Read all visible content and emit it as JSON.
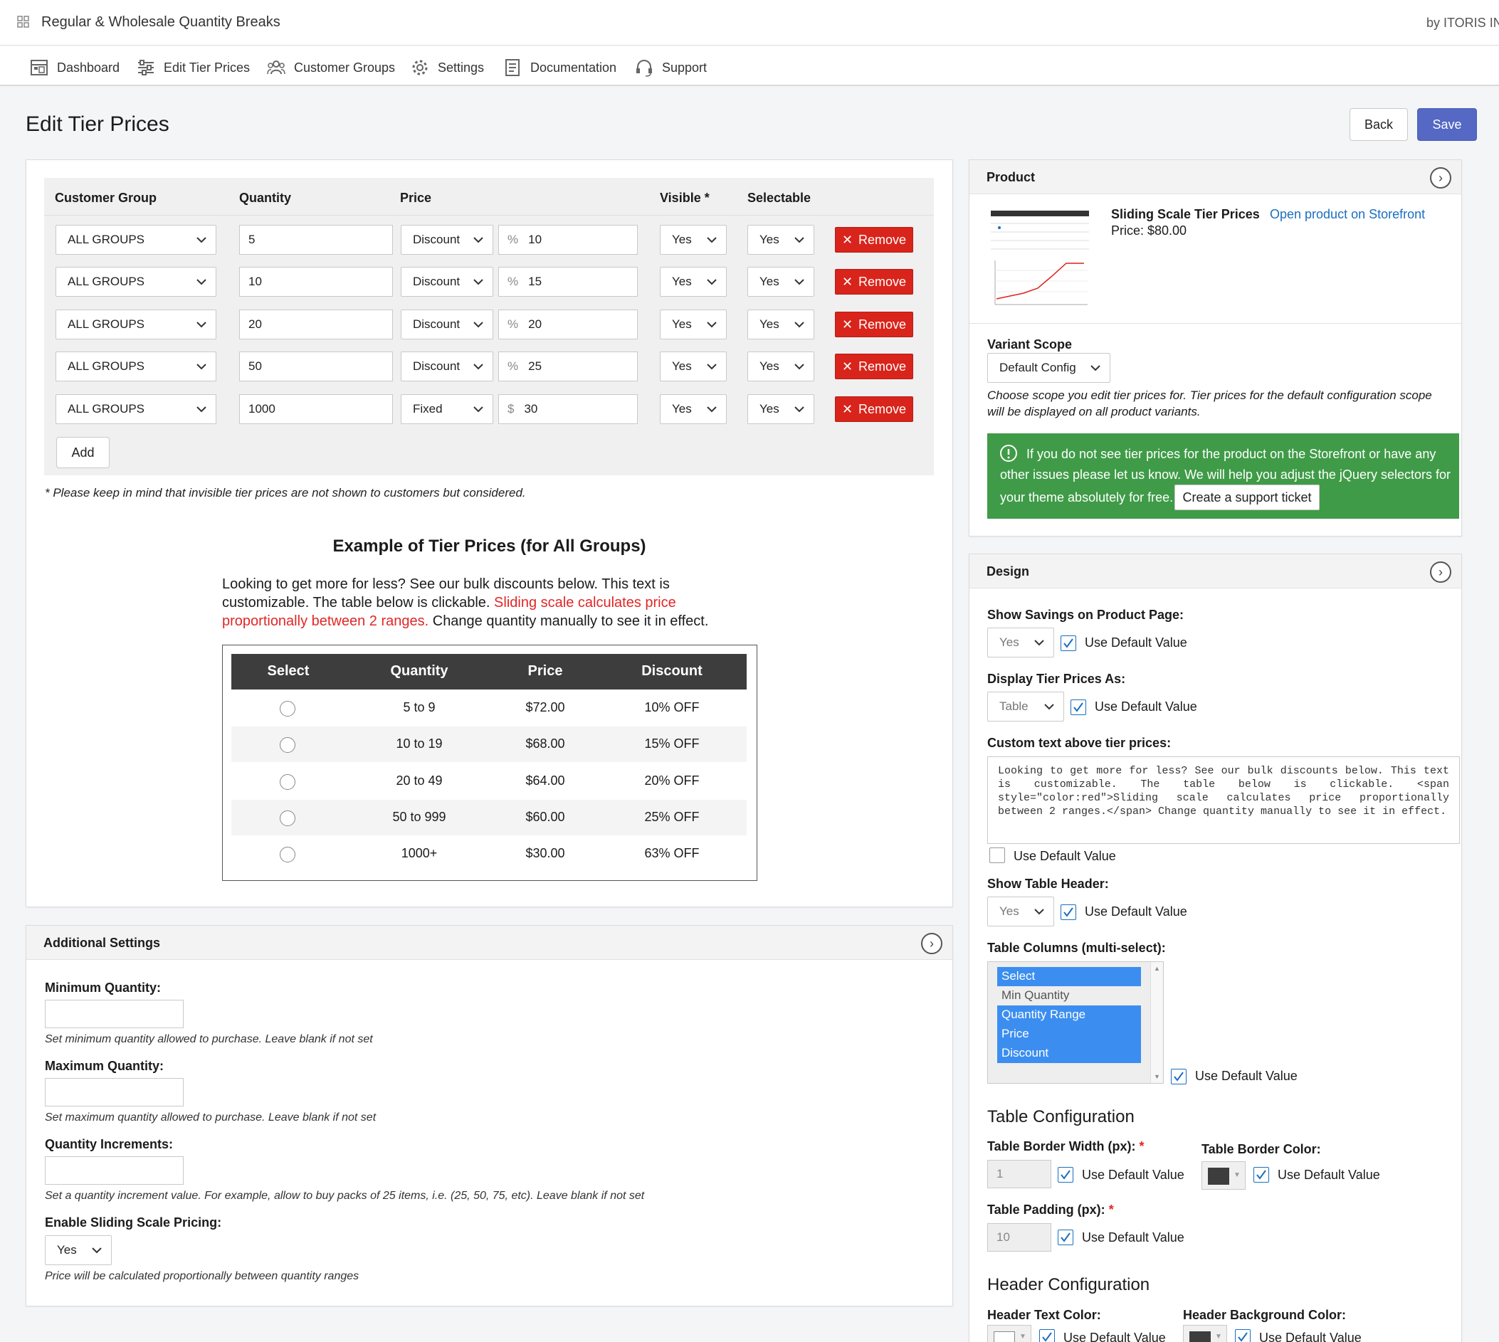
{
  "app": {
    "title": "Regular & Wholesale Quantity Breaks",
    "vendor": "by ITORIS INC"
  },
  "nav": [
    {
      "label": "Dashboard",
      "icon": "dashboard-icon"
    },
    {
      "label": "Edit Tier Prices",
      "icon": "sliders-icon"
    },
    {
      "label": "Customer Groups",
      "icon": "users-icon"
    },
    {
      "label": "Settings",
      "icon": "gear-icon"
    },
    {
      "label": "Documentation",
      "icon": "document-icon"
    },
    {
      "label": "Support",
      "icon": "headset-icon"
    }
  ],
  "page": {
    "title": "Edit Tier Prices",
    "back": "Back",
    "save": "Save"
  },
  "tiers": {
    "headers": {
      "group": "Customer Group",
      "quantity": "Quantity",
      "price": "Price",
      "visible": "Visible *",
      "selectable": "Selectable"
    },
    "rows": [
      {
        "group": "ALL GROUPS",
        "qty": "5",
        "type": "Discount",
        "prefix": "%",
        "value": "10",
        "visible": "Yes",
        "selectable": "Yes"
      },
      {
        "group": "ALL GROUPS",
        "qty": "10",
        "type": "Discount",
        "prefix": "%",
        "value": "15",
        "visible": "Yes",
        "selectable": "Yes"
      },
      {
        "group": "ALL GROUPS",
        "qty": "20",
        "type": "Discount",
        "prefix": "%",
        "value": "20",
        "visible": "Yes",
        "selectable": "Yes"
      },
      {
        "group": "ALL GROUPS",
        "qty": "50",
        "type": "Discount",
        "prefix": "%",
        "value": "25",
        "visible": "Yes",
        "selectable": "Yes"
      },
      {
        "group": "ALL GROUPS",
        "qty": "1000",
        "type": "Fixed",
        "prefix": "$",
        "value": "30",
        "visible": "Yes",
        "selectable": "Yes"
      }
    ],
    "remove": "Remove",
    "add": "Add",
    "note": "* Please keep in mind that invisible tier prices are not shown to customers but considered."
  },
  "example": {
    "title": "Example of Tier Prices (for All Groups)",
    "text1": "Looking to get more for less? See our bulk discounts below. This text is",
    "text2a": "customizable. The table below is clickable. ",
    "text2b": "Sliding scale calculates price",
    "text3a": "proportionally between 2 ranges.",
    "text3b": " Change quantity manually to see it in effect.",
    "headers": [
      "Select",
      "Quantity",
      "Price",
      "Discount"
    ],
    "rows": [
      {
        "qty": "5 to 9",
        "price": "$72.00",
        "disc": "10% OFF"
      },
      {
        "qty": "10 to 19",
        "price": "$68.00",
        "disc": "15% OFF"
      },
      {
        "qty": "20 to 49",
        "price": "$64.00",
        "disc": "20% OFF"
      },
      {
        "qty": "50 to 999",
        "price": "$60.00",
        "disc": "25% OFF"
      },
      {
        "qty": "1000+",
        "price": "$30.00",
        "disc": "63% OFF"
      }
    ]
  },
  "additional": {
    "title": "Additional Settings",
    "min_label": "Minimum Quantity:",
    "min_hint": "Set minimum quantity allowed to purchase. Leave blank if not set",
    "max_label": "Maximum Quantity:",
    "max_hint": "Set maximum quantity allowed to purchase. Leave blank if not set",
    "inc_label": "Quantity Increments:",
    "inc_hint": "Set a quantity increment value. For example, allow to buy packs of 25 items, i.e. (25, 50, 75, etc). Leave blank if not set",
    "slide_label": "Enable Sliding Scale Pricing:",
    "slide_value": "Yes",
    "slide_hint": "Price will be calculated proportionally between quantity ranges"
  },
  "product": {
    "title": "Product",
    "name": "Sliding Scale Tier Prices",
    "link": "Open product on Storefront",
    "price": "Price: $80.00",
    "scope_label": "Variant Scope",
    "scope_value": "Default Config",
    "scope_hint1": "Choose scope you edit tier prices for. Tier prices for the default configuration scope",
    "scope_hint2": "will be displayed on all product variants.",
    "alert1": "If you do not see tier prices for the product on the Storefront or have any",
    "alert2": "other issues please let us know. We will help you adjust the jQuery selectors for",
    "alert3": "your theme absolutely for free.",
    "ticket": "Create a support ticket"
  },
  "design": {
    "title": "Design",
    "savings_label": "Show Savings on Product Page:",
    "savings_value": "Yes",
    "display_label": "Display Tier Prices As:",
    "display_value": "Table",
    "custom_label": "Custom text above tier prices:",
    "custom_text": "Looking to get more for less? See our bulk discounts below. This text is customizable. The table below is clickable. <span style=\"color:red\">Sliding scale calculates price proportionally between 2 ranges.</span> Change quantity manually to see it in effect.",
    "header_label": "Show Table Header:",
    "header_value": "Yes",
    "columns_label": "Table Columns (multi-select):",
    "columns": [
      {
        "label": "Select",
        "selected": true
      },
      {
        "label": "Min Quantity",
        "selected": false
      },
      {
        "label": "Quantity Range",
        "selected": true
      },
      {
        "label": "Price",
        "selected": true
      },
      {
        "label": "Discount",
        "selected": true
      }
    ],
    "use_default": "Use Default Value",
    "table_config": "Table Configuration",
    "border_width_label": "Table Border Width (px):",
    "border_width_value": "1",
    "border_color_label": "Table Border Color:",
    "padding_label": "Table Padding (px):",
    "padding_value": "10",
    "header_config": "Header Configuration",
    "header_text_color_label": "Header Text Color:",
    "header_bg_color_label": "Header Background Color:",
    "req": "*"
  },
  "colors": {
    "save": "#5468c4",
    "remove": "#d9241b",
    "alert": "#3f9b47",
    "link": "#1a6fc0",
    "highlight": "#e22626",
    "table_header": "#3d3d3d",
    "select_blue": "#3b8ef0"
  }
}
